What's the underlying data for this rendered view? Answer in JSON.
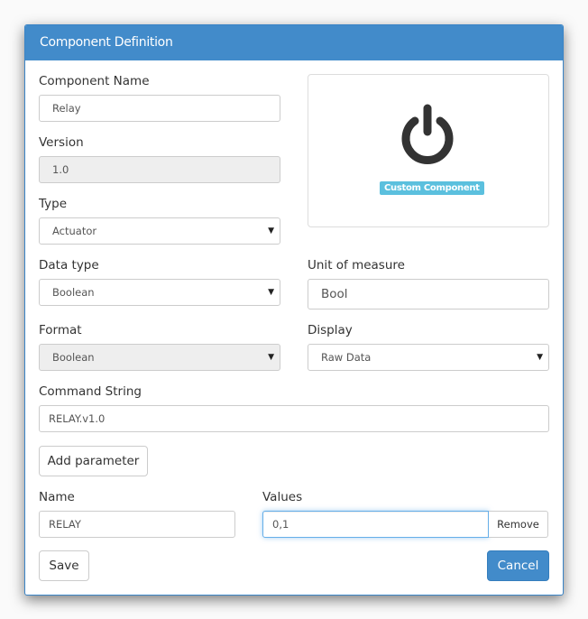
{
  "modal": {
    "title": "Component Definition"
  },
  "form": {
    "component_name": {
      "label": "Component Name",
      "value": "Relay"
    },
    "version": {
      "label": "Version",
      "value": "1.0"
    },
    "type": {
      "label": "Type",
      "value": "Actuator"
    },
    "data_type": {
      "label": "Data type",
      "value": "Boolean"
    },
    "unit_of_measure": {
      "label": "Unit of measure",
      "value": "Bool"
    },
    "format": {
      "label": "Format",
      "value": "Boolean"
    },
    "display": {
      "label": "Display",
      "value": "Raw Data"
    },
    "command_string": {
      "label": "Command String",
      "value": "RELAY.v1.0"
    }
  },
  "preview": {
    "icon": "power-icon",
    "badge": "Custom Component",
    "badge_color": "#5bc0de"
  },
  "parameters": {
    "add_label": "Add parameter",
    "name_label": "Name",
    "values_label": "Values",
    "rows": [
      {
        "name": "RELAY",
        "values": "0,1",
        "remove_label": "Remove"
      }
    ]
  },
  "footer": {
    "save_label": "Save",
    "cancel_label": "Cancel"
  },
  "colors": {
    "header": "#428bca",
    "primary_button": "#428bca",
    "badge": "#5bc0de"
  },
  "icons": {
    "select_caret": "▼"
  }
}
